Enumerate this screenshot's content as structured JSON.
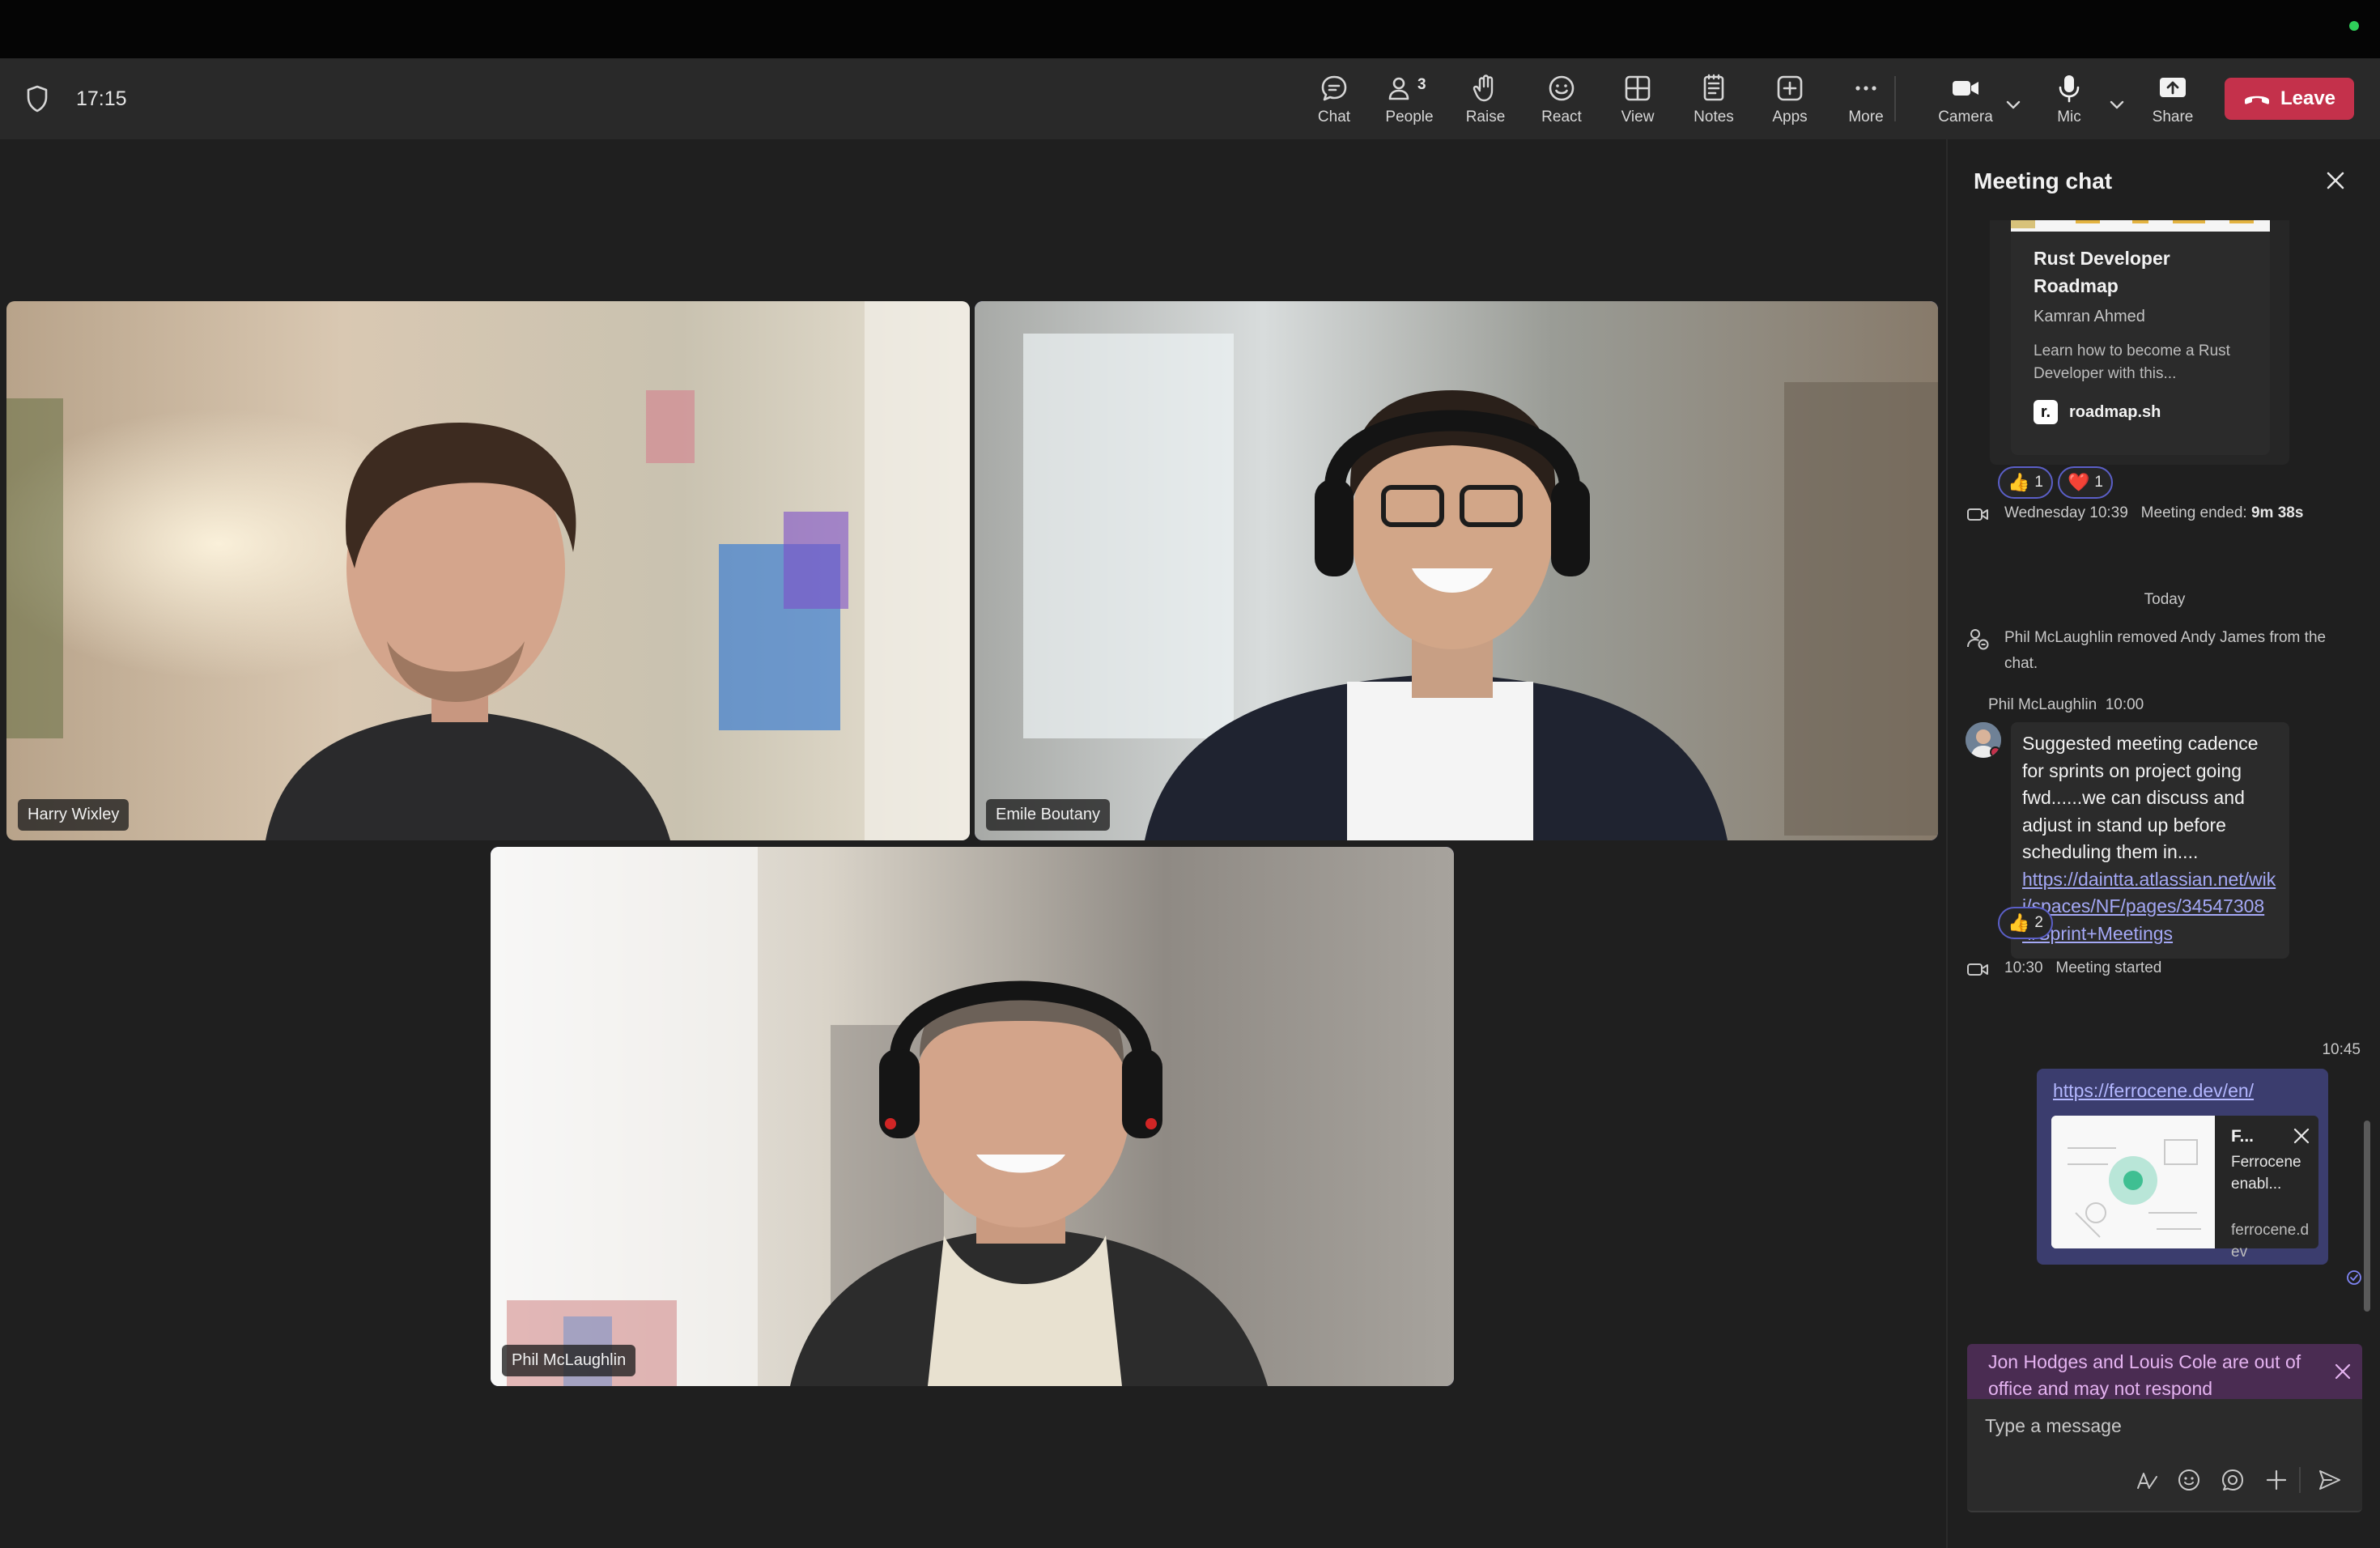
{
  "clock": "17:15",
  "toolbar": {
    "chat": "Chat",
    "people": "People",
    "people_count": "3",
    "raise": "Raise",
    "react": "React",
    "view": "View",
    "notes": "Notes",
    "apps": "Apps",
    "more": "More",
    "camera": "Camera",
    "mic": "Mic",
    "share": "Share",
    "leave": "Leave",
    "accent": "#7f85f5",
    "leave_color": "#c4314b"
  },
  "participants": [
    {
      "name": "Harry Wixley",
      "speaking": false
    },
    {
      "name": "Emile Boutany",
      "speaking": true
    },
    {
      "name": "Phil McLaughlin",
      "speaking": true
    }
  ],
  "chat": {
    "title": "Meeting chat",
    "card": {
      "title": "Rust Developer Roadmap",
      "author": "Kamran Ahmed",
      "description": "Learn how to become a Rust Developer with this...",
      "site": "roadmap.sh",
      "site_logo": "r."
    },
    "card_reactions": [
      {
        "emoji": "👍",
        "count": "1"
      },
      {
        "emoji": "❤️",
        "count": "1"
      }
    ],
    "meeting_ended": {
      "time": "Wednesday 10:39",
      "label": "Meeting ended:",
      "duration": "9m 38s"
    },
    "divider": "Today",
    "removed_notice": "Phil McLaughlin removed Andy James from the chat.",
    "message": {
      "sender": "Phil McLaughlin",
      "time": "10:00",
      "text": "Suggested meeting cadence for sprints on project going fwd......we can discuss and adjust in stand up before scheduling them in....",
      "link": "https://daintta.atlassian.net/wiki/spaces/NF/pages/345473084/Sprint+Meetings",
      "reaction": {
        "emoji": "👍",
        "count": "2"
      }
    },
    "meeting_started": {
      "time": "10:30",
      "label": "Meeting started"
    },
    "my_message": {
      "time": "10:45",
      "link": "https://ferrocene.dev/en/",
      "preview_title": "F...",
      "preview_desc": "Ferrocene enabl...",
      "preview_site": "ferrocene.dev"
    },
    "out_of_office": "Jon Hodges and Louis Cole are out of office and may not respond",
    "composer_placeholder": "Type a message"
  }
}
